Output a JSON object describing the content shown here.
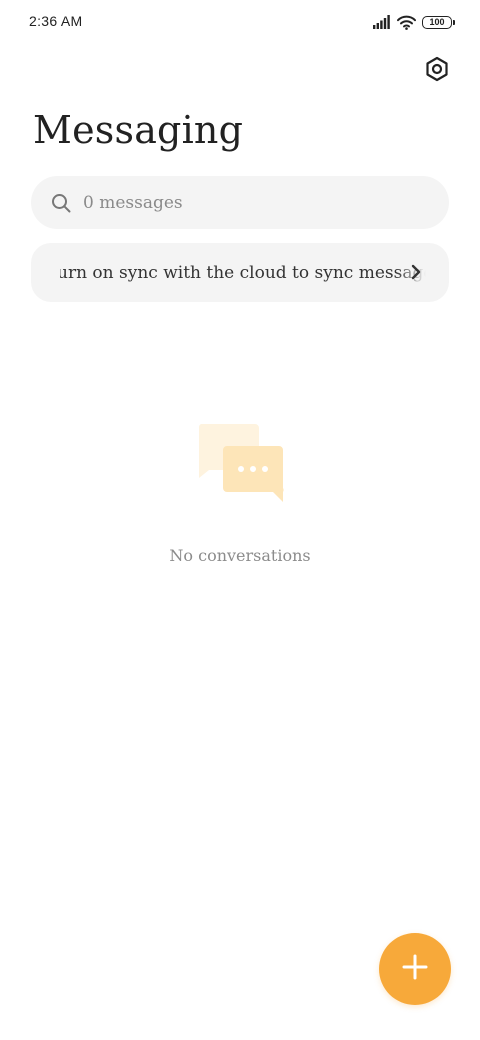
{
  "status_bar": {
    "time": "2:36 AM",
    "battery": "100",
    "icons": [
      "signal-icon",
      "wifi-icon",
      "battery-icon"
    ]
  },
  "header": {
    "title": "Messaging",
    "settings_icon": "settings-icon"
  },
  "search": {
    "placeholder": "0 messages"
  },
  "sync_banner": {
    "text": "urn on sync with the cloud to sync message",
    "chevron_icon": "chevron-right-icon"
  },
  "empty_state": {
    "icon": "chat-bubbles-icon",
    "text": "No conversations"
  },
  "fab": {
    "icon": "plus-icon"
  },
  "colors": {
    "accent": "#f7a93a",
    "illustration": "#fde9c3"
  }
}
